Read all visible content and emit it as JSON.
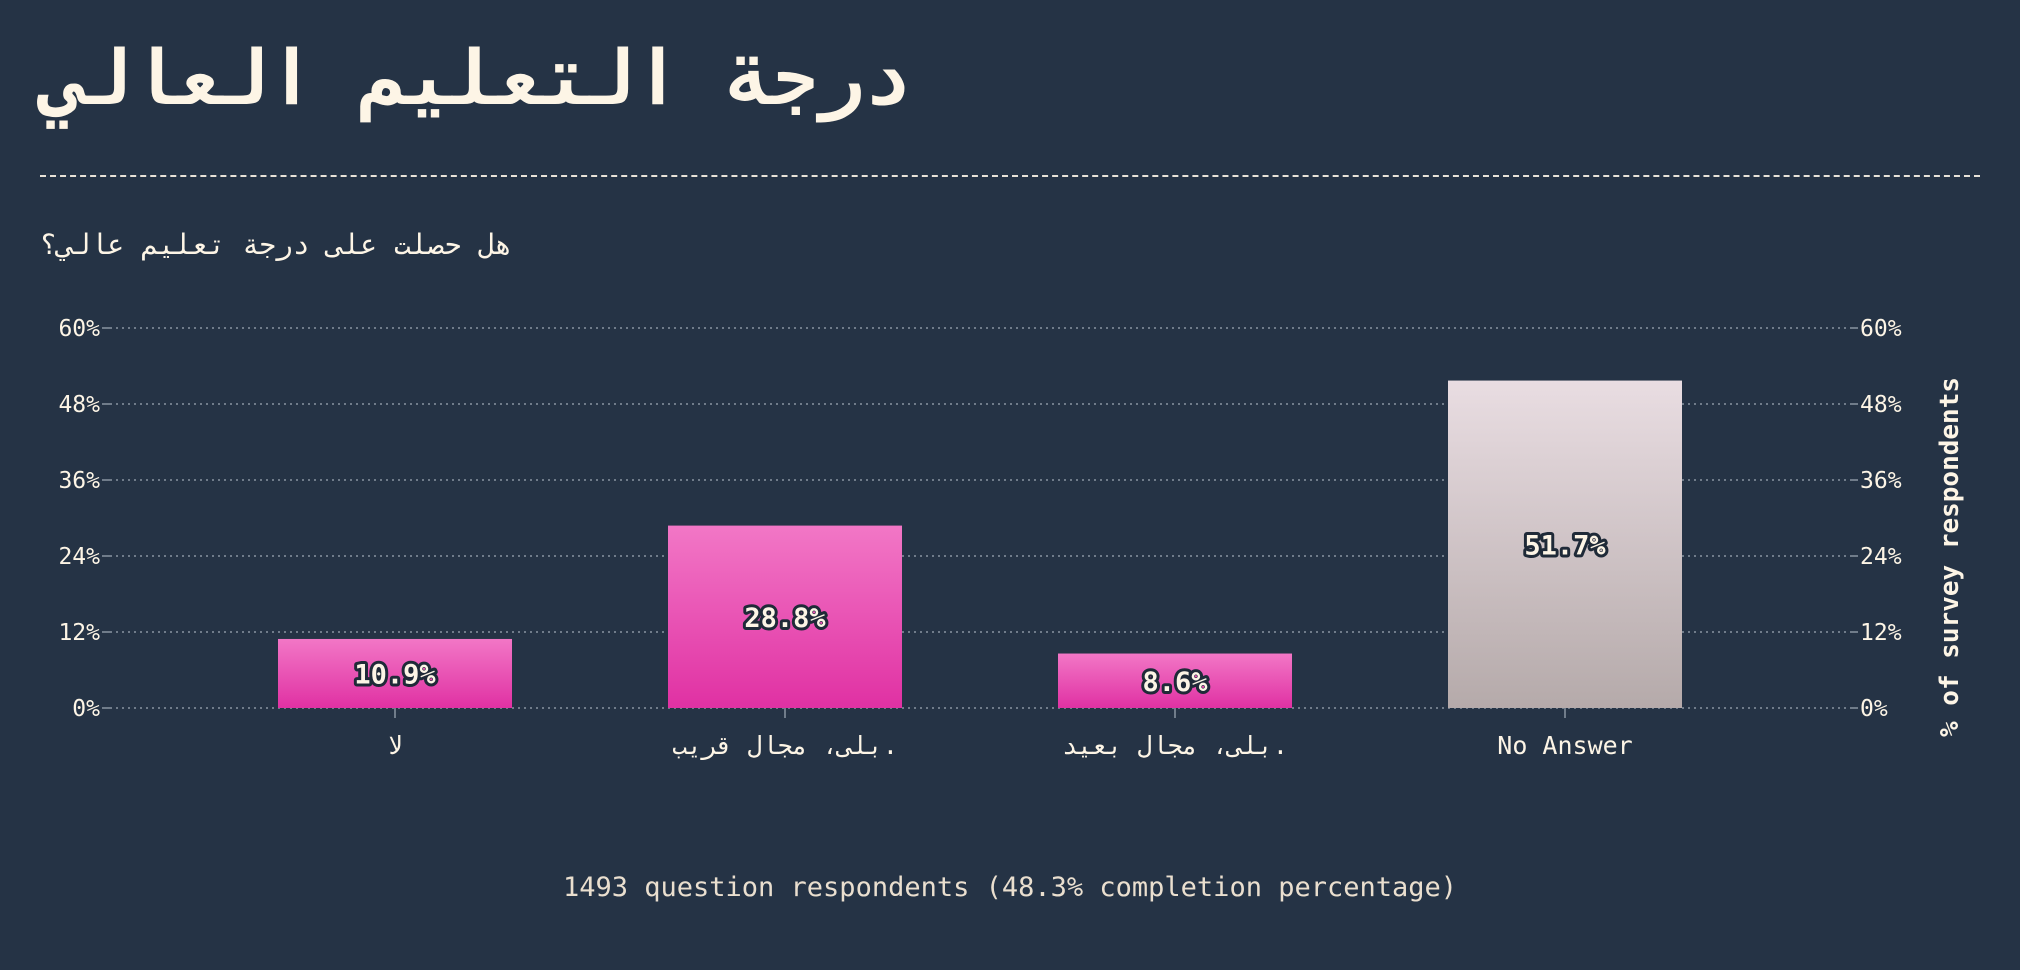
{
  "title": "درجة التعليم العالي",
  "subtitle": "هل حصلت على درجة تعليم عالي؟",
  "footer": "1493 question respondents (48.3% completion percentage)",
  "chart_data": {
    "type": "bar",
    "categories": [
      "لا",
      "بلى، مجال قريب.",
      "بلى، مجال بعيد.",
      "No Answer"
    ],
    "values": [
      10.9,
      28.8,
      8.6,
      51.7
    ],
    "value_labels": [
      "10.9%",
      "28.8%",
      "8.6%",
      "51.7%"
    ],
    "ylabel": "% of survey respondents",
    "ylim": [
      0,
      60
    ],
    "yticks": [
      0,
      12,
      24,
      36,
      48,
      60
    ],
    "ytick_labels": [
      "0%",
      "12%",
      "24%",
      "36%",
      "48%",
      "60%"
    ],
    "grid": true,
    "colors": {
      "answer_top": "#f277c6",
      "answer_bottom": "#e031a3",
      "no_answer_top": "#e9dde2",
      "no_answer_bottom": "#b5aaaa",
      "grid": "#8a94a2"
    }
  }
}
